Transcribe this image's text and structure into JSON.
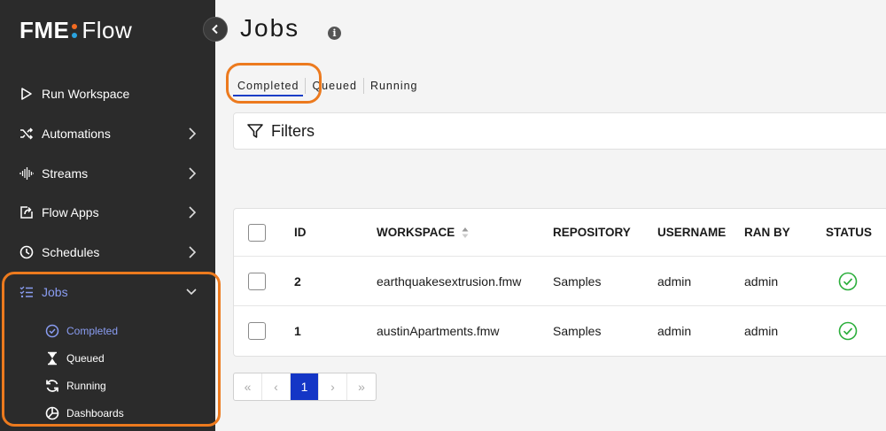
{
  "brand": {
    "fme": "FME",
    "flow": "Flow"
  },
  "sidebar": {
    "items": [
      {
        "label": "Run Workspace",
        "icon": "play-icon"
      },
      {
        "label": "Automations",
        "icon": "shuffle-icon"
      },
      {
        "label": "Streams",
        "icon": "waveform-icon"
      },
      {
        "label": "Flow Apps",
        "icon": "share-box-icon"
      },
      {
        "label": "Schedules",
        "icon": "clock-icon"
      },
      {
        "label": "Jobs",
        "icon": "checklist-icon"
      }
    ],
    "jobs_sub": [
      {
        "label": "Completed",
        "icon": "check-circle-icon"
      },
      {
        "label": "Queued",
        "icon": "hourglass-icon"
      },
      {
        "label": "Running",
        "icon": "refresh-icon"
      },
      {
        "label": "Dashboards",
        "icon": "pie-chart-icon"
      }
    ]
  },
  "page": {
    "title": "Jobs",
    "info": "i"
  },
  "tabs": [
    "Completed",
    "Queued",
    "Running"
  ],
  "filters": {
    "label": "Filters"
  },
  "table": {
    "columns": [
      "ID",
      "WORKSPACE",
      "REPOSITORY",
      "USERNAME",
      "RAN BY",
      "STATUS"
    ],
    "rows": [
      {
        "id": "2",
        "workspace": "earthquakesextrusion.fmw",
        "repository": "Samples",
        "username": "admin",
        "ran_by": "admin",
        "status": "success"
      },
      {
        "id": "1",
        "workspace": "austinApartments.fmw",
        "repository": "Samples",
        "username": "admin",
        "ran_by": "admin",
        "status": "success"
      }
    ]
  },
  "pager": {
    "first": "«",
    "prev": "‹",
    "current": "1",
    "next": "›",
    "last": "»"
  },
  "colors": {
    "sidebar_bg": "#2b2b2b",
    "accent": "#1436c6",
    "active_nav": "#8a9df2",
    "highlight": "#ec7a1e",
    "success": "#2bae3b"
  }
}
